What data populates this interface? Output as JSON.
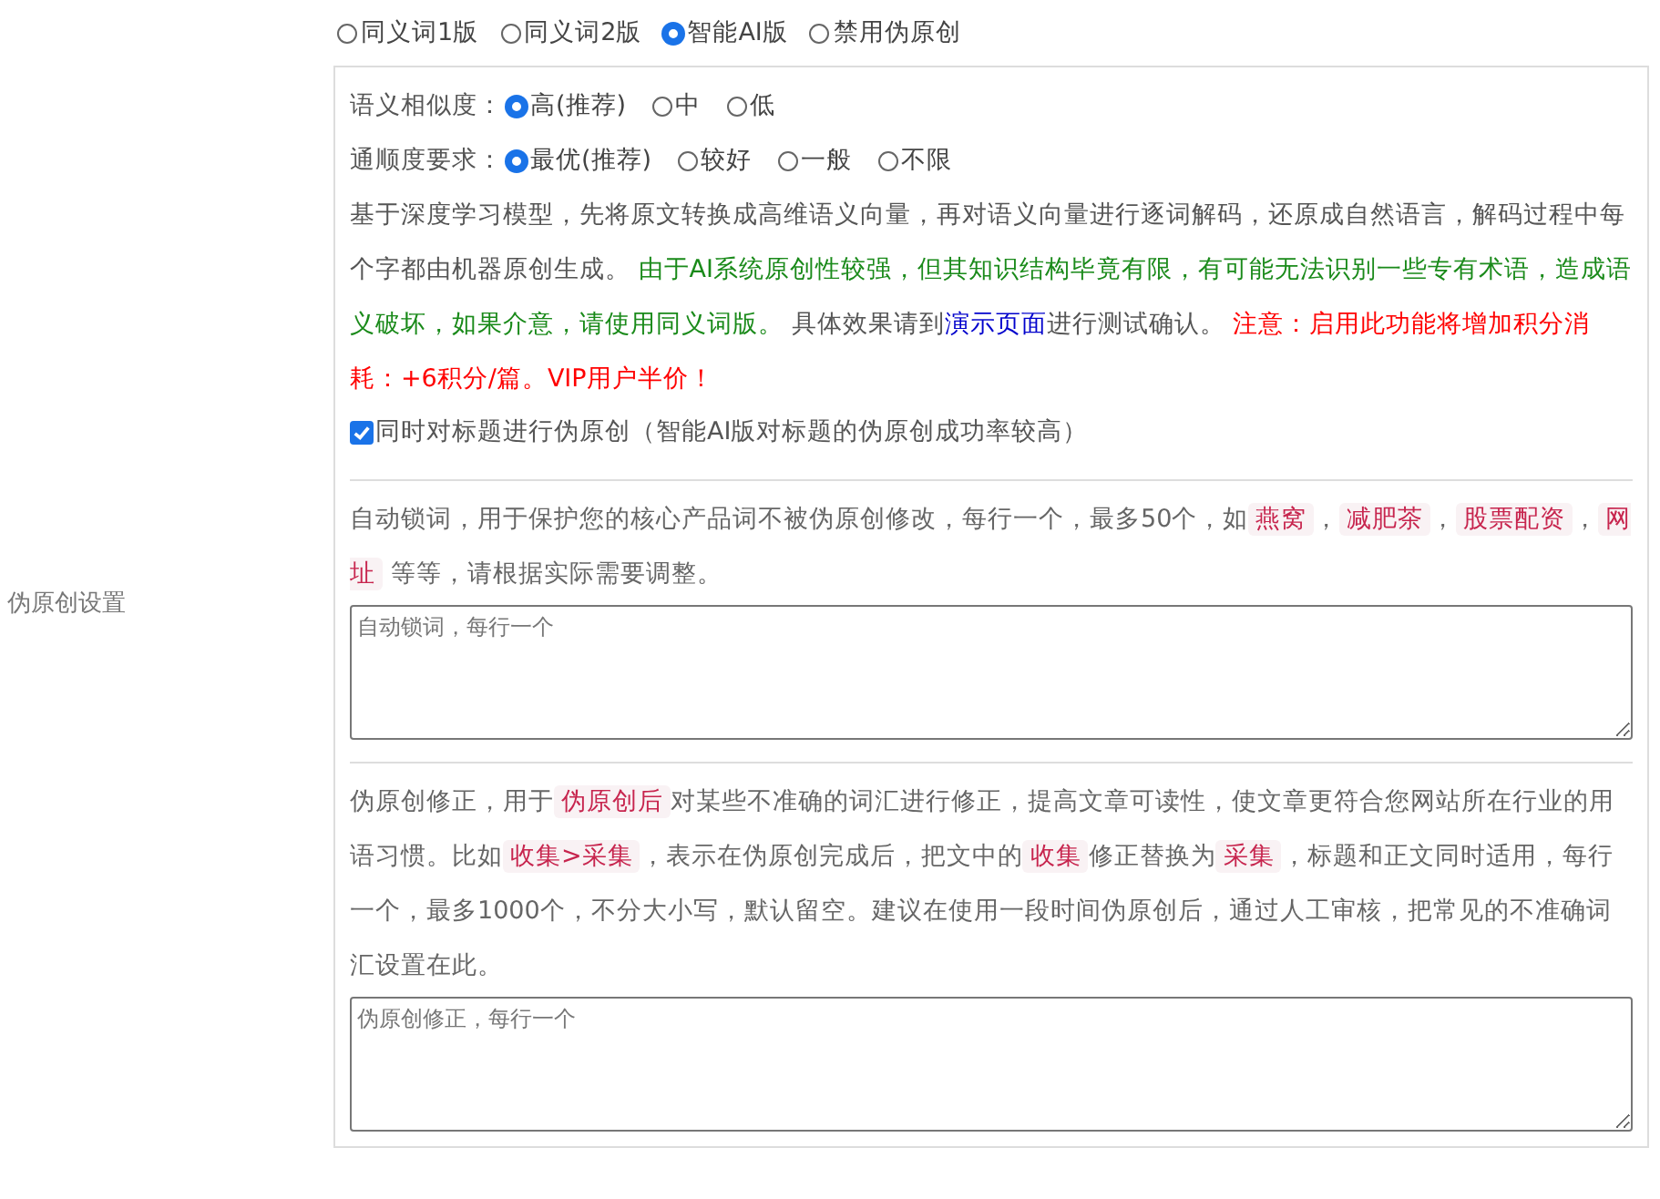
{
  "side_label": "伪原创设置",
  "mode_options": [
    {
      "label": "同义词1版",
      "selected": false
    },
    {
      "label": "同义词2版",
      "selected": false
    },
    {
      "label": "智能AI版",
      "selected": true
    },
    {
      "label": "禁用伪原创",
      "selected": false
    }
  ],
  "ai_settings": {
    "radio_groups": [
      {
        "label": "语义相似度：",
        "options": [
          {
            "label": "高(推荐)",
            "selected": true
          },
          {
            "label": "中",
            "selected": false
          },
          {
            "label": "低",
            "selected": false
          }
        ]
      },
      {
        "label": "通顺度要求：",
        "options": [
          {
            "label": "最优(推荐)",
            "selected": true
          },
          {
            "label": "较好",
            "selected": false
          },
          {
            "label": "一般",
            "selected": false
          },
          {
            "label": "不限",
            "selected": false
          }
        ]
      }
    ],
    "description": [
      {
        "kind": "plain",
        "text": "基于深度学习模型，先将原文转换成高维语义向量，再对语义向量进行逐词解码，还原成自然语言，解码过程中每个字都由机器原创生成。 "
      },
      {
        "kind": "green",
        "text": "由于AI系统原创性较强，但其知识结构毕竟有限，有可能无法识别一些专有术语，造成语义破坏，如果介意，请使用同义词版。"
      },
      {
        "kind": "plain",
        "text": " 具体效果请到"
      },
      {
        "kind": "link",
        "text": "演示页面"
      },
      {
        "kind": "plain",
        "text": "进行测试确认。 "
      },
      {
        "kind": "red",
        "text": "注意：启用此功能将增加积分消耗：+6积分/篇。VIP用户半价！"
      }
    ],
    "title_checkbox": {
      "label": "同时对标题进行伪原创（智能AI版对标题的伪原创成功率较高）",
      "checked": true
    }
  },
  "lock_words": {
    "description": [
      {
        "kind": "plain",
        "text": "自动锁词，用于保护您的核心产品词不被伪原创修改，每行一个，最多50个，如"
      },
      {
        "kind": "tag",
        "text": "燕窝"
      },
      {
        "kind": "plain",
        "text": "，"
      },
      {
        "kind": "tag",
        "text": "减肥茶"
      },
      {
        "kind": "plain",
        "text": "，"
      },
      {
        "kind": "tag",
        "text": "股票配资"
      },
      {
        "kind": "plain",
        "text": "，"
      },
      {
        "kind": "tag",
        "text": "网址"
      },
      {
        "kind": "plain",
        "text": " 等等，请根据实际需要调整。"
      }
    ],
    "placeholder": "自动锁词，每行一个"
  },
  "correction": {
    "description": [
      {
        "kind": "plain",
        "text": "伪原创修正，用于"
      },
      {
        "kind": "tag",
        "text": "伪原创后"
      },
      {
        "kind": "plain",
        "text": "对某些不准确的词汇进行修正，提高文章可读性，使文章更符合您网站所在行业的用语习惯。比如"
      },
      {
        "kind": "tag",
        "text": "收集>采集"
      },
      {
        "kind": "plain",
        "text": "，表示在伪原创完成后，把文中的"
      },
      {
        "kind": "tag",
        "text": "收集"
      },
      {
        "kind": "plain",
        "text": "修正替换为"
      },
      {
        "kind": "tag",
        "text": "采集"
      },
      {
        "kind": "plain",
        "text": "，标题和正文同时适用，每行一个，最多1000个，不分大小写，默认留空。建议在使用一段时间伪原创后，通过人工审核，把常见的不准确词汇设置在此。"
      }
    ],
    "placeholder": "伪原创修正，每行一个"
  }
}
